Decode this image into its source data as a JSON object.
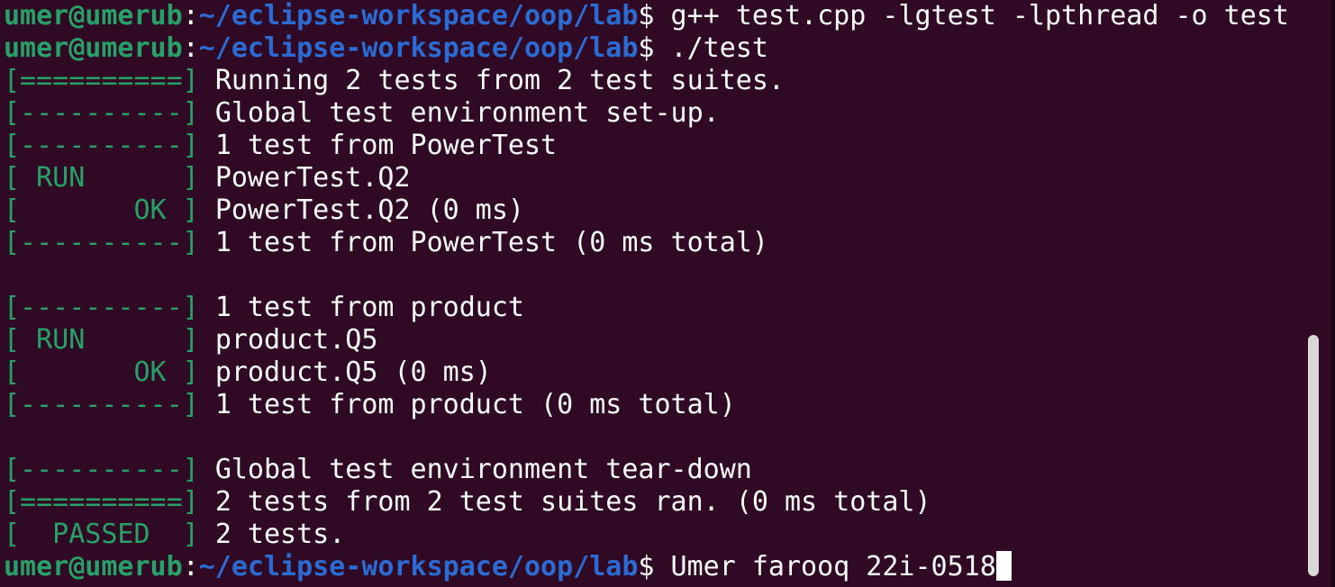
{
  "colors": {
    "background": "#300a24",
    "prompt_user": "#26a269",
    "prompt_path": "#2a6bd4",
    "gtest_tag": "#26a269",
    "text": "#ffffff"
  },
  "prompt": {
    "user_host": "umer@umerub",
    "path": "~/eclipse-workspace/oop/lab"
  },
  "lines": [
    {
      "type": "prompt",
      "command": "g++ test.cpp -lgtest -lpthread -o test"
    },
    {
      "type": "prompt",
      "command": "./test"
    },
    {
      "type": "gtest",
      "tag": "[==========]",
      "text": "Running 2 tests from 2 test suites."
    },
    {
      "type": "gtest",
      "tag": "[----------]",
      "text": "Global test environment set-up."
    },
    {
      "type": "gtest",
      "tag": "[----------]",
      "text": "1 test from PowerTest"
    },
    {
      "type": "gtest",
      "tag": "[ RUN      ]",
      "text": "PowerTest.Q2"
    },
    {
      "type": "gtest",
      "tag": "[       OK ]",
      "text": "PowerTest.Q2 (0 ms)"
    },
    {
      "type": "gtest",
      "tag": "[----------]",
      "text": "1 test from PowerTest (0 ms total)"
    },
    {
      "type": "blank"
    },
    {
      "type": "gtest",
      "tag": "[----------]",
      "text": "1 test from product"
    },
    {
      "type": "gtest",
      "tag": "[ RUN      ]",
      "text": "product.Q5"
    },
    {
      "type": "gtest",
      "tag": "[       OK ]",
      "text": "product.Q5 (0 ms)"
    },
    {
      "type": "gtest",
      "tag": "[----------]",
      "text": "1 test from product (0 ms total)"
    },
    {
      "type": "blank"
    },
    {
      "type": "gtest",
      "tag": "[----------]",
      "text": "Global test environment tear-down"
    },
    {
      "type": "gtest",
      "tag": "[==========]",
      "text": "2 tests from 2 test suites ran. (0 ms total)"
    },
    {
      "type": "gtest",
      "tag": "[  PASSED  ]",
      "text": "2 tests."
    },
    {
      "type": "prompt",
      "command": "Umer farooq 22i-0518",
      "cursor": true
    }
  ],
  "scrollbar": {
    "visible_fraction": 0.41,
    "position": "bottom"
  }
}
